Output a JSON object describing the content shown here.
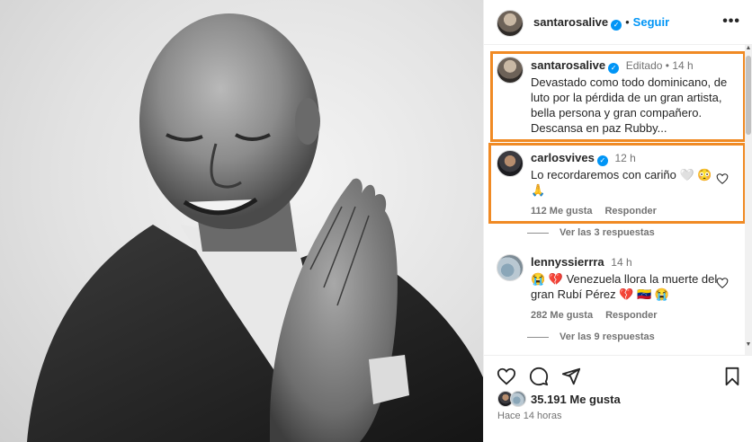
{
  "post": {
    "author": "santarosalive",
    "follow_label": "Seguir",
    "more_label": "•••",
    "caption": {
      "username": "santarosalive",
      "edited": "Editado",
      "time": "14 h",
      "text": "Devastado como todo dominicano, de luto por la pérdida de un gran artista, bella persona y gran compañero. Descansa en paz Rubby..."
    },
    "likes": "35.191 Me gusta",
    "posted": "Hace 14 horas"
  },
  "comments": [
    {
      "username": "carlosvives",
      "verified": true,
      "time": "12 h",
      "text": "Lo recordaremos con cariño 🤍 😳 🙏",
      "likes": "112 Me gusta",
      "reply_label": "Responder",
      "view_replies": "Ver las 3 respuestas"
    },
    {
      "username": "lennyssierrra",
      "verified": false,
      "time": "14 h",
      "text": "😭 💔 Venezuela llora la muerte del gran Rubí Pérez 💔 🇻🇪 😭",
      "likes": "282 Me gusta",
      "reply_label": "Responder",
      "view_replies": "Ver las 9 respuestas"
    }
  ],
  "icons": {
    "like": "heart-icon",
    "comment": "comment-icon",
    "share": "share-icon",
    "save": "bookmark-icon",
    "verified": "verified-badge-icon"
  },
  "colors": {
    "accent": "#0095f6",
    "highlight": "#f08a24",
    "text": "#262626",
    "muted": "#737373"
  }
}
